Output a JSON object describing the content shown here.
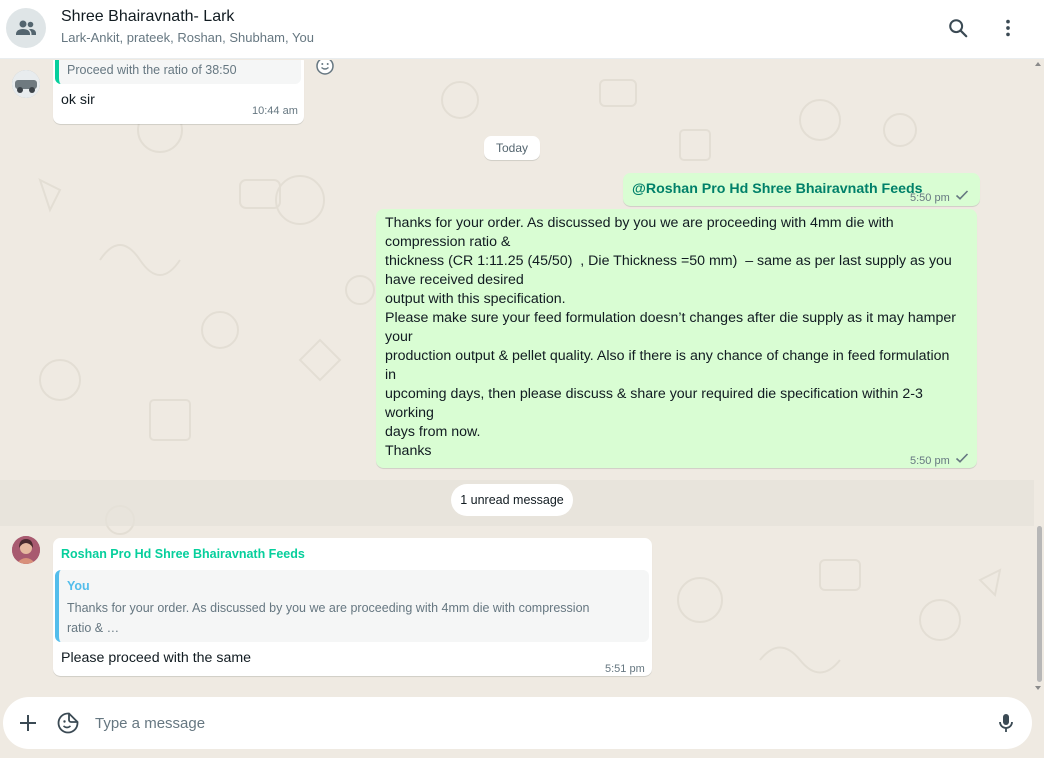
{
  "header": {
    "title": "Shree Bhairavnath- Lark",
    "participants": "Lark-Ankit, prateek, Roshan, Shubham, You",
    "icons": [
      "group-icon",
      "search-icon",
      "menu-icon"
    ]
  },
  "messages": {
    "m1": {
      "quote_text": "Proceed with the ratio of 38:50",
      "text": "ok sir",
      "time": "10:44 am"
    },
    "date_divider": "Today",
    "m2": {
      "mention": "@Roshan Pro Hd Shree Bhairavnath Feeds",
      "time": "5:50 pm"
    },
    "m3": {
      "lines": [
        "Thanks for your order. As discussed by you we are proceeding with 4mm die with",
        "compression ratio &",
        "thickness (CR 1:11.25 (45/50)  , Die Thickness =50 mm)  – same as per last supply as you",
        "have received desired",
        "output with this specification.",
        "Please make sure your feed formulation doesn’t changes after die supply as it may hamper",
        "your",
        "production output & pellet quality. Also if there is any chance of change in feed formulation",
        "in",
        "upcoming days, then please discuss & share your required die specification within 2-3",
        "working",
        "days from now.",
        "Thanks"
      ],
      "time": "5:50 pm"
    },
    "unread": "1 unread message",
    "m4": {
      "sender": "Roshan Pro Hd Shree Bhairavnath Feeds",
      "quote_author": "You",
      "quote_line1": "Thanks for your order. As discussed by you we are proceeding with 4mm die with compression",
      "quote_line2": "ratio & …",
      "text": "Please proceed with the same",
      "time": "5:51 pm"
    }
  },
  "composer": {
    "placeholder": "Type a message",
    "icons": [
      "plus-icon",
      "sticker-icon",
      "mic-icon"
    ]
  },
  "colors": {
    "accent_green": "#06cf9c",
    "mention_green": "#008069",
    "outgoing_bubble": "#d9fdd3",
    "quote_you": "#53bdeb"
  }
}
